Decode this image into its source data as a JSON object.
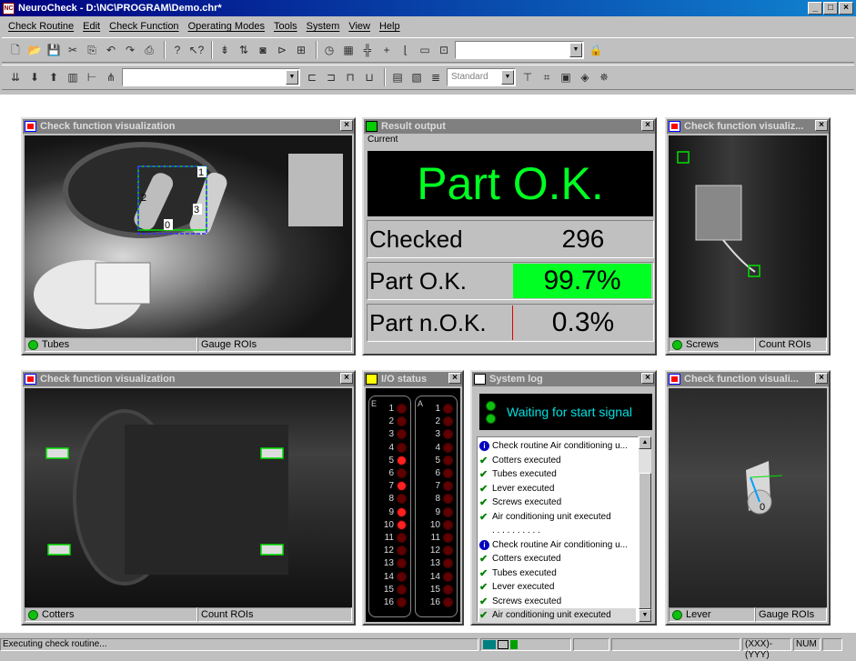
{
  "window": {
    "title": "NeuroCheck - D:\\NC\\PROGRAM\\Demo.chr*",
    "app_icon": "NC"
  },
  "menu": [
    "Check Routine",
    "Edit",
    "Check Function",
    "Operating Modes",
    "Tools",
    "System",
    "View",
    "Help"
  ],
  "toolbar": {
    "combo_standard": "Standard"
  },
  "windows": {
    "tubes": {
      "title": "Check function visualization",
      "name": "Tubes",
      "type": "Gauge ROIs",
      "roi_labels": [
        "1",
        "2",
        "3",
        "0"
      ]
    },
    "result": {
      "title": "Result output",
      "current_label": "Current",
      "banner": "Part O.K.",
      "rows": [
        {
          "label": "Checked",
          "value": "296"
        },
        {
          "label": "Part O.K.",
          "value": "99.7%"
        },
        {
          "label": "Part n.O.K.",
          "value": "0.3%"
        }
      ]
    },
    "screws": {
      "title": "Check function visualiz...",
      "name": "Screws",
      "type": "Count ROIs"
    },
    "cotters": {
      "title": "Check function visualization",
      "name": "Cotters",
      "type": "Count ROIs"
    },
    "io": {
      "title": "I/O status",
      "e_label": "E",
      "a_label": "A",
      "inputs_on": [
        5,
        7,
        9,
        10
      ],
      "numbers": [
        "1",
        "2",
        "3",
        "4",
        "5",
        "6",
        "7",
        "8",
        "9",
        "10",
        "11",
        "12",
        "13",
        "14",
        "15",
        "16"
      ]
    },
    "syslog": {
      "title": "System log",
      "status": "Waiting for start signal",
      "lines": [
        {
          "kind": "info",
          "text": "Check routine Air conditioning u..."
        },
        {
          "kind": "ok",
          "text": "Cotters executed"
        },
        {
          "kind": "ok",
          "text": "Tubes executed"
        },
        {
          "kind": "ok",
          "text": "Lever executed"
        },
        {
          "kind": "ok",
          "text": "Screws executed"
        },
        {
          "kind": "ok",
          "text": "Air conditioning unit executed"
        },
        {
          "kind": "sep",
          "text": ". . . . . . . . . ."
        },
        {
          "kind": "info",
          "text": "Check routine Air conditioning u..."
        },
        {
          "kind": "ok",
          "text": "Cotters executed"
        },
        {
          "kind": "ok",
          "text": "Tubes executed"
        },
        {
          "kind": "ok",
          "text": "Lever executed"
        },
        {
          "kind": "ok",
          "text": "Screws executed"
        },
        {
          "kind": "ok",
          "text": "Air conditioning unit executed"
        }
      ]
    },
    "lever": {
      "title": "Check function visuali...",
      "name": "Lever",
      "type": "Gauge ROIs",
      "roi_label": "0"
    }
  },
  "statusbar": {
    "message": "Executing check routine...",
    "field_x": "(XXX)-(YYY)",
    "num": "NUM"
  },
  "colors": {
    "ok_green": "#00ff22",
    "banner_bg": "#000000",
    "syslog_text": "#00e0e0",
    "led_on": "#ff2020"
  }
}
